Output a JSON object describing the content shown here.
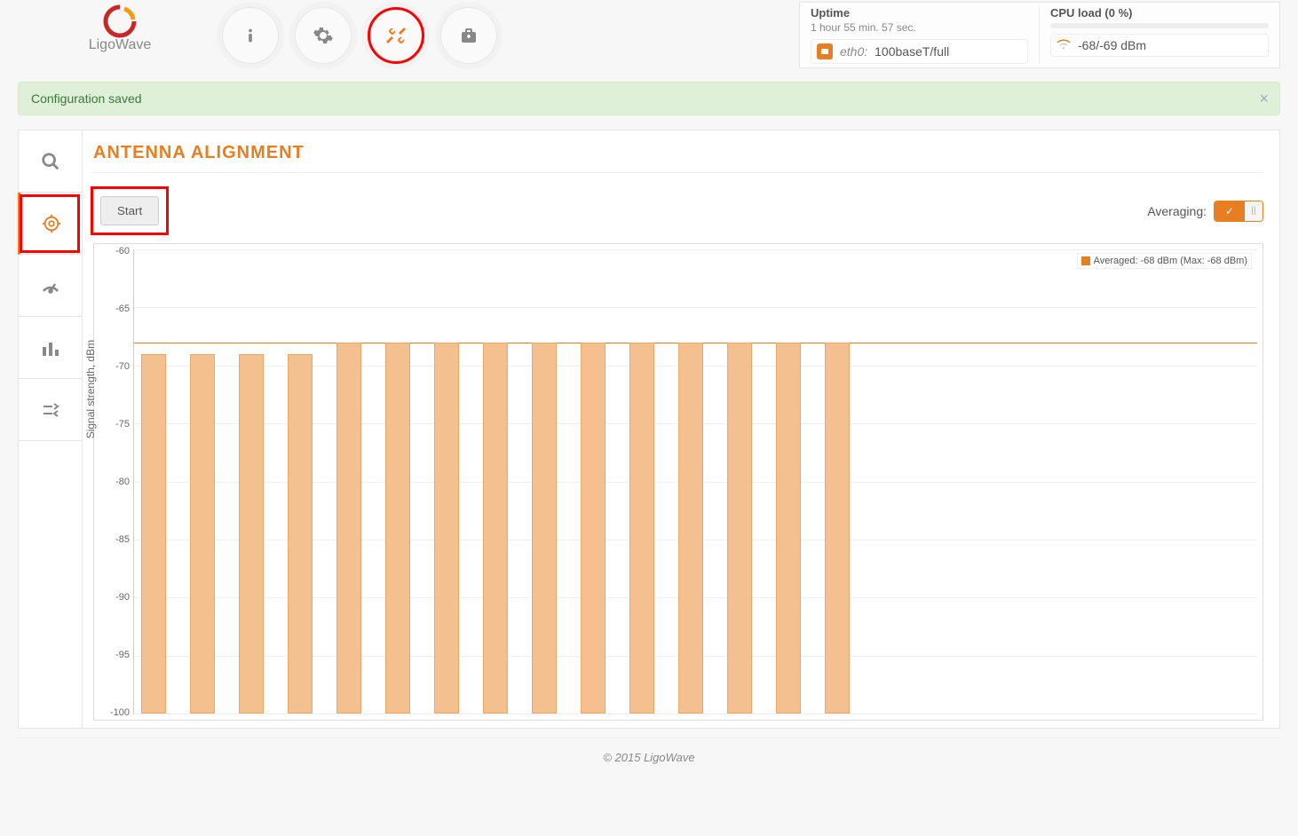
{
  "brand": "LigoWave",
  "stats": {
    "uptime_label": "Uptime",
    "uptime_value": "1 hour 55 min. 57 sec.",
    "cpu_label": "CPU load (0 %)",
    "eth_if": "eth0:",
    "eth_val": "100baseT/full",
    "wifi_val": "-68/-69 dBm"
  },
  "alert": {
    "text": "Configuration saved"
  },
  "page": {
    "title": "ANTENNA ALIGNMENT",
    "start_label": "Start",
    "averaging_label": "Averaging:"
  },
  "chart_data": {
    "type": "bar",
    "ylabel": "Signal strength, dBm",
    "ylim": [
      -100,
      -60
    ],
    "yticks": [
      -60,
      -65,
      -70,
      -75,
      -80,
      -85,
      -90,
      -95,
      -100
    ],
    "values": [
      -69,
      -69,
      -69,
      -69,
      -68,
      -68,
      -68,
      -68,
      -68,
      -68,
      -68,
      -68,
      -68,
      -68,
      -68
    ],
    "avg_line": -68,
    "legend": "Averaged: -68 dBm (Max: -68 dBm)"
  },
  "footer": "© 2015 LigoWave"
}
